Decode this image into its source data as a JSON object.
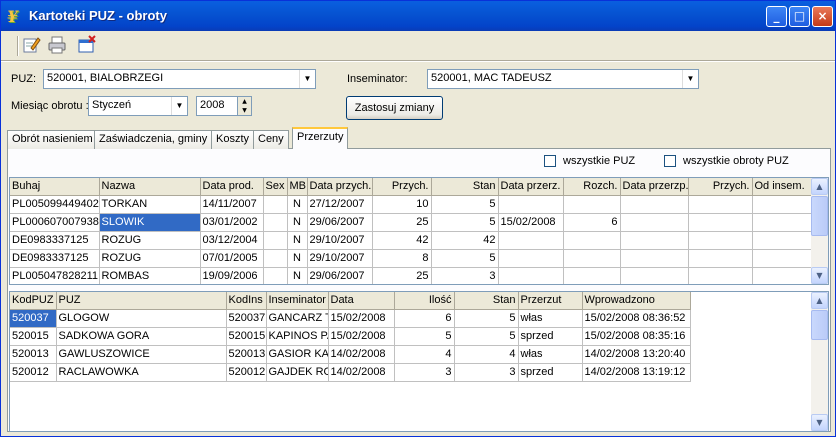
{
  "window": {
    "title": "Kartoteki PUZ - obroty"
  },
  "title_buttons": {
    "minimize": "_",
    "maximize": "□",
    "close": "×"
  },
  "form": {
    "puz_label": "PUZ:",
    "puz_value": "520001, BIALOBRZEGI",
    "inseminator_label": "Inseminator:",
    "inseminator_value": "520001, MAC TADEUSZ",
    "month_label": "Miesiąc obrotu :",
    "month_value": "Styczeń",
    "year_value": "2008",
    "apply_button": "Zastosuj zmiany"
  },
  "tabs": [
    {
      "label": "Obrót nasieniem"
    },
    {
      "label": "Zaświadczenia, gminy"
    },
    {
      "label": "Koszty"
    },
    {
      "label": "Ceny"
    },
    {
      "label": "Przerzuty"
    }
  ],
  "checkboxes": {
    "all_puz": "wszystkie PUZ",
    "all_obroty": "wszystkie obroty PUZ"
  },
  "top_table": {
    "columns": [
      "Buhaj",
      "Nazwa",
      "Data prod.",
      "Sex",
      "MB",
      "Data przych.",
      "Przych.",
      "Stan",
      "Data przerz.",
      "Rozch.",
      "Data przerzp.",
      "Przych.",
      "Od insem."
    ],
    "rows": [
      [
        "PL005099449402",
        "TORKAN",
        "14/11/2007",
        "",
        "N",
        "27/12/2007",
        "10",
        "5",
        "",
        "",
        "",
        "",
        ""
      ],
      [
        "PL000607007938",
        "SLOWIK",
        "03/01/2002",
        "",
        "N",
        "29/06/2007",
        "25",
        "5",
        "15/02/2008",
        "6",
        "",
        "",
        ""
      ],
      [
        "DE0983337125",
        "ROZUG",
        "03/12/2004",
        "",
        "N",
        "29/10/2007",
        "42",
        "42",
        "",
        "",
        "",
        "",
        ""
      ],
      [
        "DE0983337125",
        "ROZUG",
        "07/01/2005",
        "",
        "N",
        "29/10/2007",
        "8",
        "5",
        "",
        "",
        "",
        "",
        ""
      ],
      [
        "PL005047828211",
        "ROMBAS",
        "19/09/2006",
        "",
        "N",
        "29/06/2007",
        "25",
        "3",
        "",
        "",
        "",
        "",
        ""
      ]
    ]
  },
  "bottom_table": {
    "columns": [
      "KodPUZ",
      "PUZ",
      "KodIns",
      "Inseminator",
      "Data",
      "Ilość",
      "Stan",
      "Przerzut",
      "Wprowadzono"
    ],
    "rows": [
      [
        "520037",
        "GLOGOW",
        "520037",
        "GANCARZ T",
        "15/02/2008",
        "6",
        "5",
        "włas",
        "15/02/2008 08:36:52"
      ],
      [
        "520015",
        "SADKOWA GORA",
        "520015",
        "KAPINOS PA",
        "15/02/2008",
        "5",
        "5",
        "sprzed",
        "15/02/2008 08:35:16"
      ],
      [
        "520013",
        "GAWLUSZOWICE",
        "520013",
        "GASIOR KAZ",
        "14/02/2008",
        "4",
        "4",
        "włas",
        "14/02/2008 13:20:40"
      ],
      [
        "520012",
        "RACLAWOWKA",
        "520012",
        "GAJDEK RO",
        "14/02/2008",
        "3",
        "3",
        "sprzed",
        "14/02/2008 13:19:12"
      ]
    ]
  },
  "icons": {
    "title": "app-icon",
    "edit": "edit-icon",
    "print": "print-icon",
    "exit": "exit-icon"
  },
  "colors": {
    "titlebar": "#0054E3",
    "selection": "#316AC5",
    "tab_highlight": "#FFC83C"
  }
}
